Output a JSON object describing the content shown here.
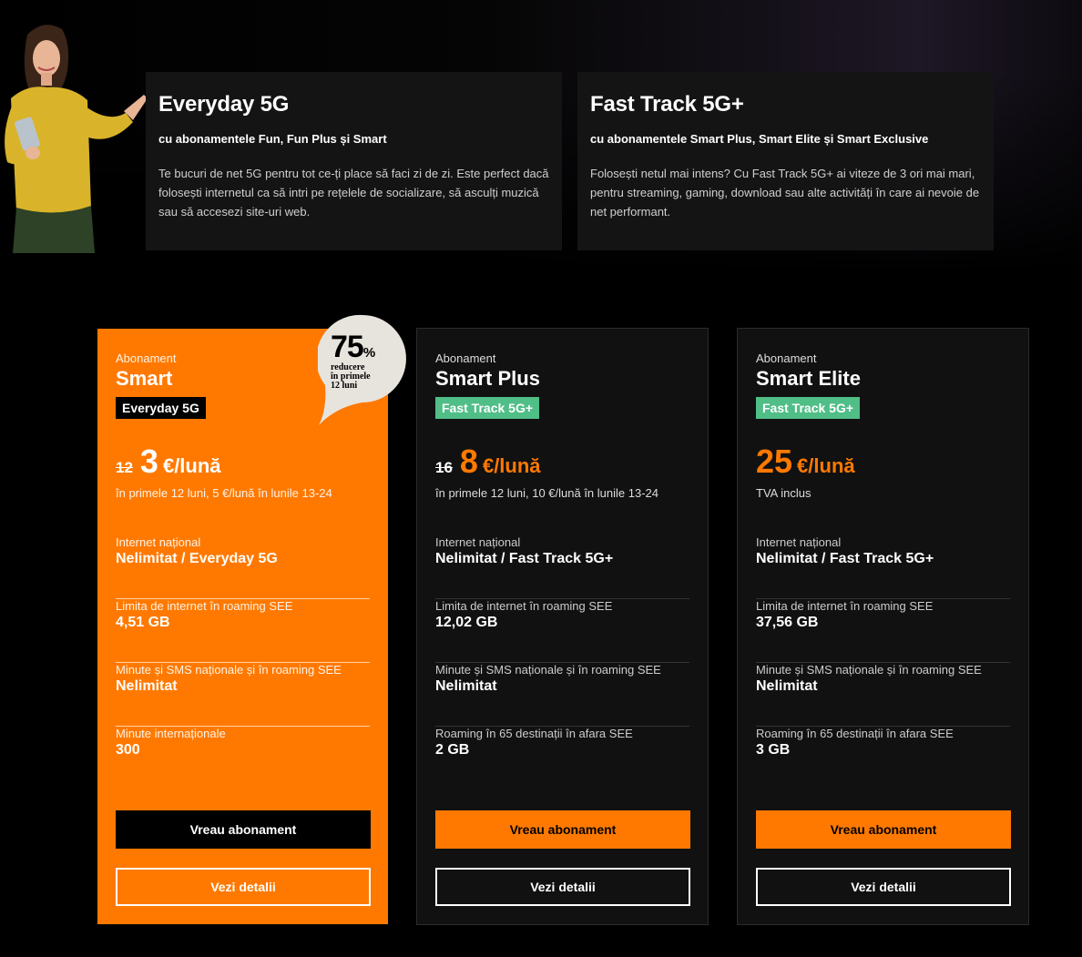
{
  "features": [
    {
      "title": "Everyday 5G",
      "subtitle": "cu abonamentele Fun, Fun Plus și Smart",
      "description": "Te bucuri de net 5G pentru tot ce-ți place să faci zi de zi. Este perfect dacă folosești internetul ca să intri pe rețelele de socializare, să asculți muzică sau să accesezi site-uri web."
    },
    {
      "title": "Fast Track 5G+",
      "subtitle": "cu abonamentele Smart Plus, Smart Elite și Smart Exclusive",
      "description": "Folosești netul mai intens? Cu Fast Track 5G+ ai viteze de 3 ori mai mari, pentru streaming, gaming, download sau alte activități în care ai nevoie de net performant."
    }
  ],
  "discount": {
    "percent": "75",
    "percent_sign": "%",
    "caption_line1": "reducere",
    "caption_line2": "în primele",
    "caption_line3": "12 luni"
  },
  "plans": [
    {
      "kicker": "Abonament",
      "name": "Smart",
      "badge": "Everyday 5G",
      "old_price": "12",
      "price": "3",
      "unit": "€/lună",
      "note": "în primele 12 luni, 5 €/lună în lunile 13-24",
      "features": [
        {
          "label": "Internet național",
          "value": "Nelimitat / Everyday 5G"
        },
        {
          "label": "Limita de internet în roaming SEE",
          "value": "4,51 GB"
        },
        {
          "label": "Minute și SMS naționale și în roaming SEE",
          "value": "Nelimitat"
        },
        {
          "label": "Minute internaționale",
          "value": "300"
        }
      ],
      "primary_button": "Vreau abonament",
      "secondary_button": "Vezi detalii"
    },
    {
      "kicker": "Abonament",
      "name": "Smart Plus",
      "badge": "Fast Track 5G+",
      "old_price": "16",
      "price": "8",
      "unit": "€/lună",
      "note": "în primele 12 luni, 10 €/lună în lunile 13-24",
      "features": [
        {
          "label": "Internet național",
          "value": "Nelimitat / Fast Track 5G+"
        },
        {
          "label": "Limita de internet în roaming SEE",
          "value": "12,02 GB"
        },
        {
          "label": "Minute și SMS naționale și în roaming SEE",
          "value": "Nelimitat"
        },
        {
          "label": "Roaming în 65 destinații în afara SEE",
          "value": "2 GB"
        }
      ],
      "primary_button": "Vreau abonament",
      "secondary_button": "Vezi detalii"
    },
    {
      "kicker": "Abonament",
      "name": "Smart Elite",
      "badge": "Fast Track 5G+",
      "old_price": "",
      "price": "25",
      "unit": "€/lună",
      "note": "TVA inclus",
      "features": [
        {
          "label": "Internet național",
          "value": "Nelimitat / Fast Track 5G+"
        },
        {
          "label": "Limita de internet în roaming SEE",
          "value": "37,56 GB"
        },
        {
          "label": "Minute și SMS naționale și în roaming SEE",
          "value": "Nelimitat"
        },
        {
          "label": "Roaming în 65 destinații în afara SEE",
          "value": "3 GB"
        }
      ],
      "primary_button": "Vreau abonament",
      "secondary_button": "Vezi detalii"
    }
  ],
  "colors": {
    "brand_orange": "#ff7900",
    "badge_green": "#50be87",
    "card_dark": "#111111"
  }
}
